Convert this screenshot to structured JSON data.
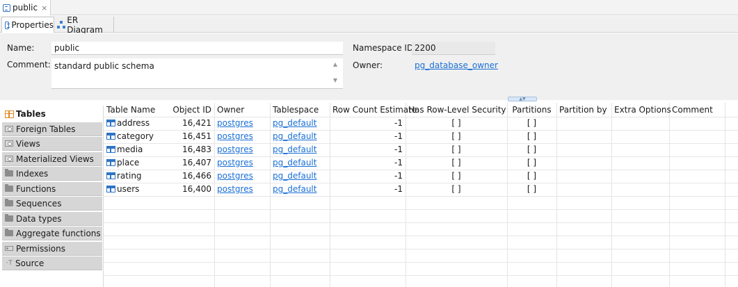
{
  "editor_tab": {
    "title": "public",
    "close": "×"
  },
  "sub_tabs": [
    {
      "label": "Properties"
    },
    {
      "label": "ER Diagram"
    }
  ],
  "properties": {
    "name_label": "Name:",
    "name_value": "public",
    "comment_label": "Comment:",
    "comment_value": "standard public schema",
    "namespace_label": "Namespace ID:",
    "namespace_value": "2200",
    "owner_label": "Owner:",
    "owner_value": "pg_database_owner"
  },
  "nav": {
    "items": [
      {
        "label": "Tables",
        "icon": "tables-icon"
      },
      {
        "label": "Foreign Tables",
        "icon": "view-icon"
      },
      {
        "label": "Views",
        "icon": "view-icon"
      },
      {
        "label": "Materialized Views",
        "icon": "view-icon"
      },
      {
        "label": "Indexes",
        "icon": "folder-icon"
      },
      {
        "label": "Functions",
        "icon": "folder-icon"
      },
      {
        "label": "Sequences",
        "icon": "folder-icon"
      },
      {
        "label": "Data types",
        "icon": "folder-icon"
      },
      {
        "label": "Aggregate functions",
        "icon": "folder-icon"
      },
      {
        "label": "Permissions",
        "icon": "key-icon"
      },
      {
        "label": "Source",
        "icon": "source-icon"
      }
    ]
  },
  "table": {
    "columns": [
      "Table Name",
      "Object ID",
      "Owner",
      "Tablespace",
      "Row Count Estimate",
      "Has Row-Level Security",
      "Partitions",
      "Partition by",
      "Extra Options",
      "Comment"
    ],
    "rows": [
      {
        "name": "address",
        "oid": "16,421",
        "owner": "postgres",
        "tablespace": "pg_default",
        "rows": "-1",
        "rls": "[ ]",
        "partitions": "[ ]"
      },
      {
        "name": "category",
        "oid": "16,451",
        "owner": "postgres",
        "tablespace": "pg_default",
        "rows": "-1",
        "rls": "[ ]",
        "partitions": "[ ]"
      },
      {
        "name": "media",
        "oid": "16,483",
        "owner": "postgres",
        "tablespace": "pg_default",
        "rows": "-1",
        "rls": "[ ]",
        "partitions": "[ ]"
      },
      {
        "name": "place",
        "oid": "16,407",
        "owner": "postgres",
        "tablespace": "pg_default",
        "rows": "-1",
        "rls": "[ ]",
        "partitions": "[ ]"
      },
      {
        "name": "rating",
        "oid": "16,466",
        "owner": "postgres",
        "tablespace": "pg_default",
        "rows": "-1",
        "rls": "[ ]",
        "partitions": "[ ]"
      },
      {
        "name": "users",
        "oid": "16,400",
        "owner": "postgres",
        "tablespace": "pg_default",
        "rows": "-1",
        "rls": "[ ]",
        "partitions": "[ ]"
      }
    ]
  },
  "colors": {
    "link": "#1a6fd6",
    "accent": "#2e74c4",
    "nav_bg": "#d6d6d6",
    "tables_icon": "#e08a1e"
  }
}
